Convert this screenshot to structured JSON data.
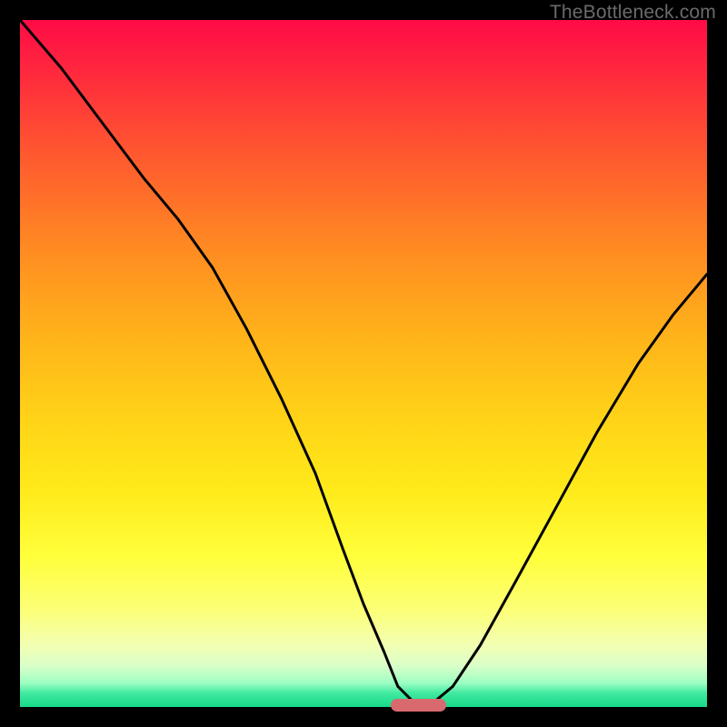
{
  "attribution": "TheBottleneck.com",
  "colors": {
    "frame": "#000000",
    "pill": "#d86a6f",
    "curve": "#000000"
  },
  "chart_data": {
    "type": "line",
    "title": "",
    "xlabel": "",
    "ylabel": "",
    "xlim": [
      0,
      100
    ],
    "ylim": [
      0,
      100
    ],
    "grid": false,
    "legend": false,
    "series": [
      {
        "name": "bottleneck-curve",
        "x": [
          0,
          6,
          12,
          18,
          23,
          28,
          33,
          38,
          43,
          47,
          50,
          53,
          55,
          57,
          58.5,
          60,
          63,
          67,
          72,
          78,
          84,
          90,
          95,
          100
        ],
        "values": [
          100,
          93,
          85,
          77,
          71,
          64,
          55,
          45,
          34,
          23,
          15,
          8,
          3,
          1,
          0,
          0.5,
          3,
          9,
          18,
          29,
          40,
          50,
          57,
          63
        ]
      }
    ],
    "annotations": {
      "optimal_marker": {
        "x_start": 54,
        "x_end": 62,
        "y": 0
      }
    }
  }
}
